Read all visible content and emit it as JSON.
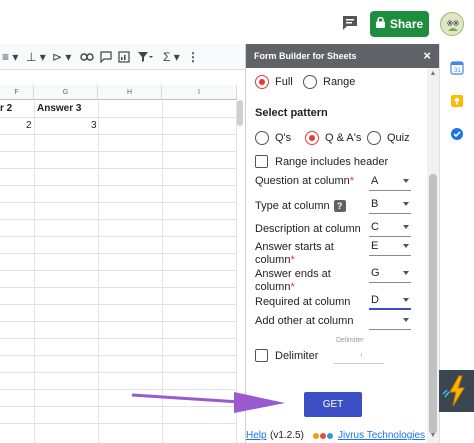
{
  "topbar": {
    "share_label": "Share",
    "colors": {
      "share_bg": "#1e8e3e"
    }
  },
  "toolbar": {
    "icons": [
      "align-icon",
      "valign-icon",
      "filter-arrow-icon",
      "link-icon",
      "comment-add-icon",
      "chart-icon",
      "filter-icon",
      "sigma-icon",
      "more-icon"
    ]
  },
  "sheet": {
    "columns": [
      "F",
      "G",
      "H",
      "I"
    ],
    "header_row": [
      "r 2",
      "Answer 3"
    ],
    "data_row": [
      "2",
      "3"
    ]
  },
  "panel": {
    "title": "Form Builder for Sheets",
    "close_label": "×",
    "range_mode": {
      "full": "Full",
      "range": "Range",
      "selected": "full"
    },
    "select_pattern_heading": "Select pattern",
    "pattern": {
      "qs": "Q's",
      "qas": "Q & A's",
      "quiz": "Quiz",
      "selected": "qas"
    },
    "range_includes_header": "Range includes header",
    "fields": [
      {
        "label": "Question at column",
        "required": true,
        "value": "A"
      },
      {
        "label": "Type at column",
        "help": "?",
        "value": "B"
      },
      {
        "label": "Description at column",
        "value": "C"
      },
      {
        "label": "Answer starts at column",
        "required": true,
        "value": "E"
      },
      {
        "label": "Answer ends at column",
        "required": true,
        "value": "G"
      },
      {
        "label": "Required at column",
        "value": "D"
      },
      {
        "label": "Add other at column",
        "value": ""
      }
    ],
    "delimiter_caption": "Delimiter",
    "delimiter_label": "Delimiter",
    "delimiter_value": ",",
    "get_label": "GET",
    "help_link": "Help",
    "version": "(v1.2.5)",
    "company": "Jivrus Technologies",
    "required_mark": "*",
    "colors": {
      "accent": "#3c4fc4",
      "radio": "#e53935",
      "header_bg": "#5f6368"
    }
  },
  "annotation": {
    "arrow_color": "#9b59d0"
  }
}
